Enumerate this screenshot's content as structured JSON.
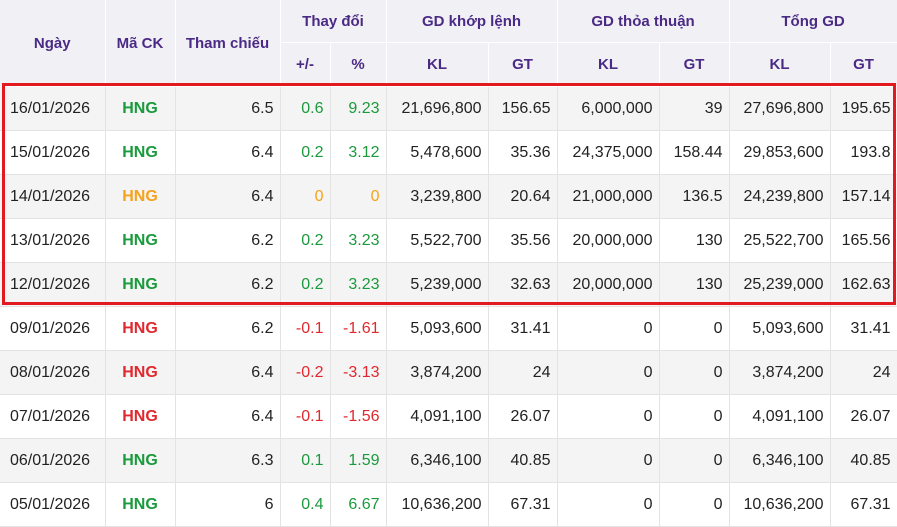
{
  "headers": {
    "date": "Ngày",
    "symbol": "Mã CK",
    "reference": "Tham chiếu",
    "change_group": "Thay đổi",
    "change_abs": "+/-",
    "change_pct": "%",
    "matched_group": "GD khớp lệnh",
    "agreed_group": "GD thỏa thuận",
    "total_group": "Tổng GD",
    "kl": "KL",
    "gt": "GT"
  },
  "rows": [
    {
      "date": "16/01/2026",
      "symbol": "HNG",
      "ref": "6.5",
      "chg": "0.6",
      "pct": "9.23",
      "m_kl": "21,696,800",
      "m_gt": "156.65",
      "a_kl": "6,000,000",
      "a_gt": "39",
      "t_kl": "27,696,800",
      "t_gt": "195.65",
      "trend": "up"
    },
    {
      "date": "15/01/2026",
      "symbol": "HNG",
      "ref": "6.4",
      "chg": "0.2",
      "pct": "3.12",
      "m_kl": "5,478,600",
      "m_gt": "35.36",
      "a_kl": "24,375,000",
      "a_gt": "158.44",
      "t_kl": "29,853,600",
      "t_gt": "193.8",
      "trend": "up"
    },
    {
      "date": "14/01/2026",
      "symbol": "HNG",
      "ref": "6.4",
      "chg": "0",
      "pct": "0",
      "m_kl": "3,239,800",
      "m_gt": "20.64",
      "a_kl": "21,000,000",
      "a_gt": "136.5",
      "t_kl": "24,239,800",
      "t_gt": "157.14",
      "trend": "ref"
    },
    {
      "date": "13/01/2026",
      "symbol": "HNG",
      "ref": "6.2",
      "chg": "0.2",
      "pct": "3.23",
      "m_kl": "5,522,700",
      "m_gt": "35.56",
      "a_kl": "20,000,000",
      "a_gt": "130",
      "t_kl": "25,522,700",
      "t_gt": "165.56",
      "trend": "up"
    },
    {
      "date": "12/01/2026",
      "symbol": "HNG",
      "ref": "6.2",
      "chg": "0.2",
      "pct": "3.23",
      "m_kl": "5,239,000",
      "m_gt": "32.63",
      "a_kl": "20,000,000",
      "a_gt": "130",
      "t_kl": "25,239,000",
      "t_gt": "162.63",
      "trend": "up"
    },
    {
      "date": "09/01/2026",
      "symbol": "HNG",
      "ref": "6.2",
      "chg": "-0.1",
      "pct": "-1.61",
      "m_kl": "5,093,600",
      "m_gt": "31.41",
      "a_kl": "0",
      "a_gt": "0",
      "t_kl": "5,093,600",
      "t_gt": "31.41",
      "trend": "down"
    },
    {
      "date": "08/01/2026",
      "symbol": "HNG",
      "ref": "6.4",
      "chg": "-0.2",
      "pct": "-3.13",
      "m_kl": "3,874,200",
      "m_gt": "24",
      "a_kl": "0",
      "a_gt": "0",
      "t_kl": "3,874,200",
      "t_gt": "24",
      "trend": "down"
    },
    {
      "date": "07/01/2026",
      "symbol": "HNG",
      "ref": "6.4",
      "chg": "-0.1",
      "pct": "-1.56",
      "m_kl": "4,091,100",
      "m_gt": "26.07",
      "a_kl": "0",
      "a_gt": "0",
      "t_kl": "4,091,100",
      "t_gt": "26.07",
      "trend": "down"
    },
    {
      "date": "06/01/2026",
      "symbol": "HNG",
      "ref": "6.3",
      "chg": "0.1",
      "pct": "1.59",
      "m_kl": "6,346,100",
      "m_gt": "40.85",
      "a_kl": "0",
      "a_gt": "0",
      "t_kl": "6,346,100",
      "t_gt": "40.85",
      "trend": "up"
    },
    {
      "date": "05/01/2026",
      "symbol": "HNG",
      "ref": "6",
      "chg": "0.4",
      "pct": "6.67",
      "m_kl": "10,636,200",
      "m_gt": "67.31",
      "a_kl": "0",
      "a_gt": "0",
      "t_kl": "10,636,200",
      "t_gt": "67.31",
      "trend": "up"
    }
  ],
  "colors": {
    "header_text": "#4b2a86",
    "up": "#1a9a3c",
    "down": "#e0282e",
    "reference": "#f5a21c",
    "highlight_border": "#e2191f"
  }
}
